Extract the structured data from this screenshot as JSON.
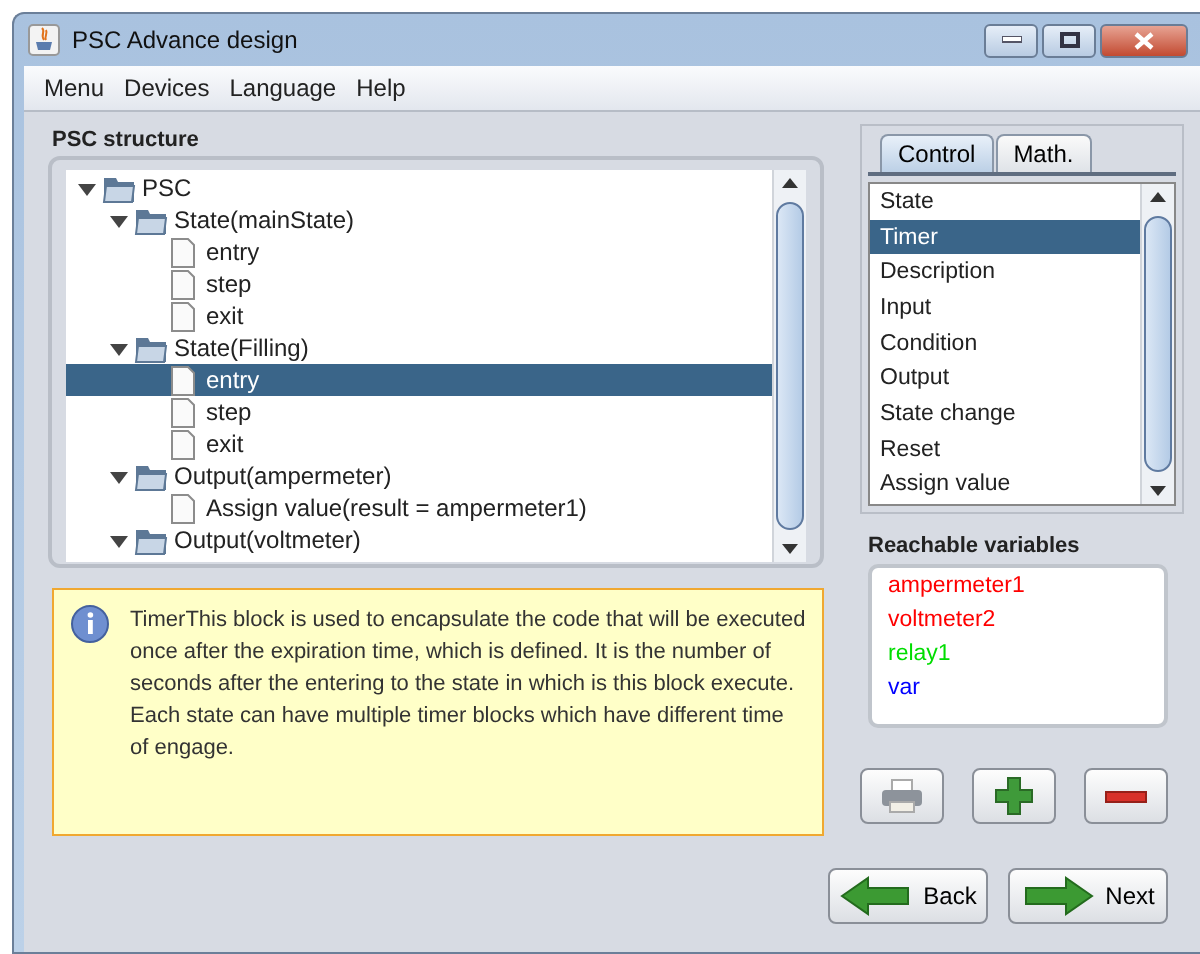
{
  "window": {
    "title": "PSC Advance design"
  },
  "menu": [
    "Menu",
    "Devices",
    "Language",
    "Help"
  ],
  "structure": {
    "title": "PSC structure",
    "tree": [
      {
        "label": "PSC",
        "kind": "folder",
        "expanded": true,
        "selected": false,
        "children": [
          {
            "label": "State(mainState)",
            "kind": "folder",
            "expanded": true,
            "selected": false,
            "children": [
              {
                "label": "entry",
                "kind": "file",
                "selected": false
              },
              {
                "label": "step",
                "kind": "file",
                "selected": false
              },
              {
                "label": "exit",
                "kind": "file",
                "selected": false
              }
            ]
          },
          {
            "label": "State(Filling)",
            "kind": "folder",
            "expanded": true,
            "selected": false,
            "children": [
              {
                "label": "entry",
                "kind": "file",
                "selected": true
              },
              {
                "label": "step",
                "kind": "file",
                "selected": false
              },
              {
                "label": "exit",
                "kind": "file",
                "selected": false
              }
            ]
          },
          {
            "label": "Output(ampermeter)",
            "kind": "folder",
            "expanded": true,
            "selected": false,
            "children": [
              {
                "label": "Assign value(result = ampermeter1)",
                "kind": "file",
                "selected": false
              }
            ]
          },
          {
            "label": "Output(voltmeter)",
            "kind": "folder",
            "expanded": true,
            "selected": false
          }
        ]
      }
    ]
  },
  "info": {
    "text": "TimerThis block is used to encapsulate the code that will be executed once after the expiration time, which is defined. It is the number of seconds after the entering to the state in which is this block execute. Each state can have multiple timer blocks which have different time of engage."
  },
  "tabs": [
    {
      "label": "Control",
      "selected": true
    },
    {
      "label": "Math.",
      "selected": false
    }
  ],
  "blocks": [
    {
      "label": "State",
      "selected": false
    },
    {
      "label": "Timer",
      "selected": true
    },
    {
      "label": "Description",
      "selected": false
    },
    {
      "label": "Input",
      "selected": false
    },
    {
      "label": "Condition",
      "selected": false
    },
    {
      "label": "Output",
      "selected": false
    },
    {
      "label": "State change",
      "selected": false
    },
    {
      "label": "Reset",
      "selected": false
    },
    {
      "label": "Assign value",
      "selected": false
    }
  ],
  "variables": {
    "title": "Reachable variables",
    "items": [
      {
        "name": "ampermeter1",
        "color": "#ff0000"
      },
      {
        "name": "voltmeter2",
        "color": "#ff0000"
      },
      {
        "name": "relay1",
        "color": "#00dd00"
      },
      {
        "name": "var",
        "color": "#0000ff"
      }
    ]
  },
  "tools": [
    {
      "kind": "print"
    },
    {
      "kind": "add"
    },
    {
      "kind": "remove"
    }
  ],
  "nav": [
    {
      "label": "Back",
      "kind": "back"
    },
    {
      "label": "Next",
      "kind": "next"
    }
  ]
}
